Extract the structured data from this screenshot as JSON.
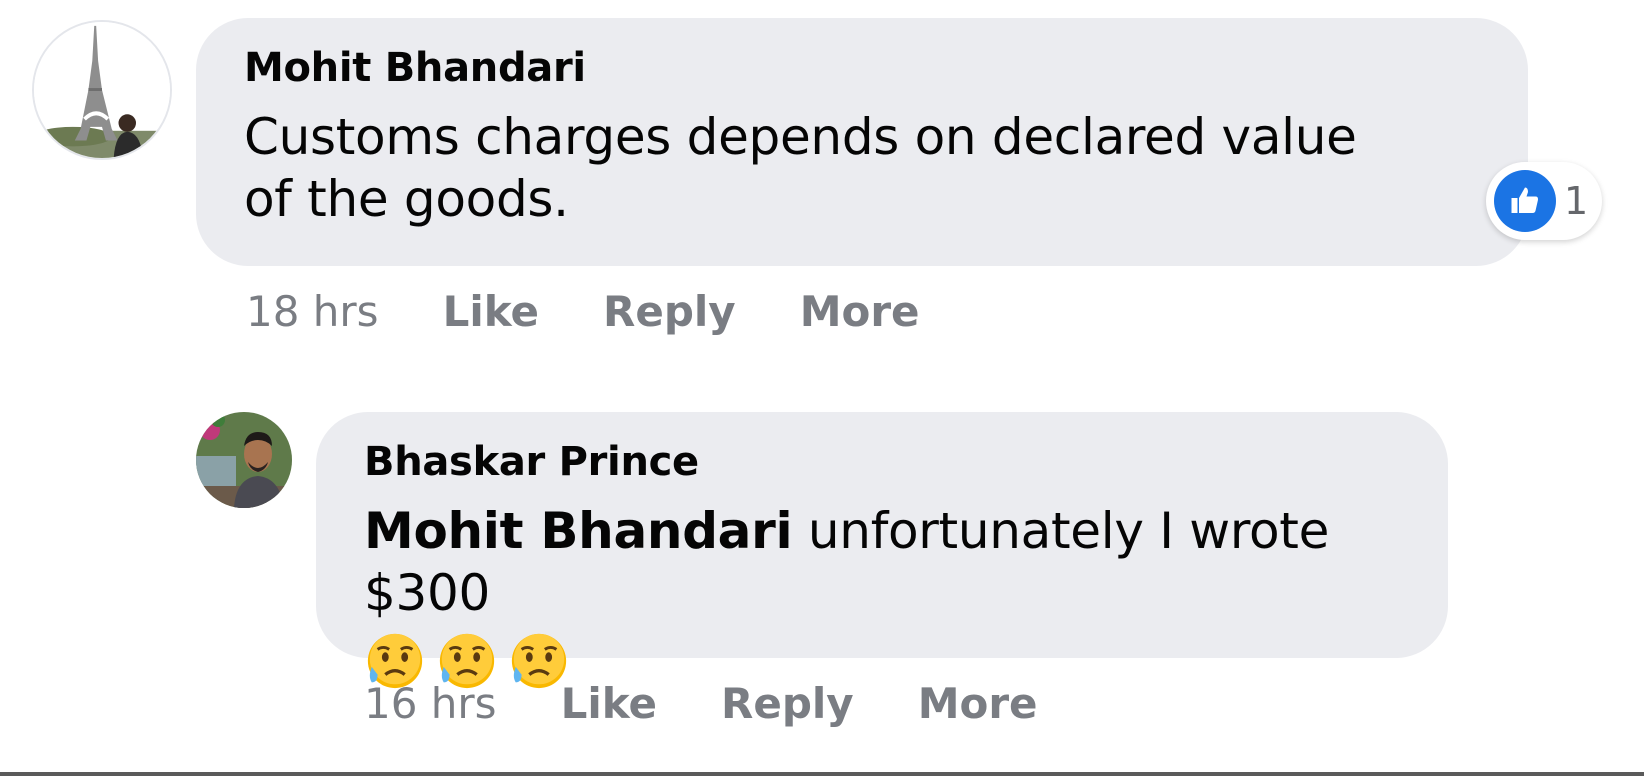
{
  "comments": [
    {
      "author": "Mohit Bhandari",
      "text": "Customs charges depends on declared value of the goods.",
      "time": "18 hrs",
      "actions": {
        "like": "Like",
        "reply": "Reply",
        "more": "More"
      },
      "reaction": {
        "icon": "thumbs-up-icon",
        "count": "1",
        "color": "#1b74e4"
      }
    },
    {
      "author": "Bhaskar Prince",
      "mention": "Mohit Bhandari",
      "text": "unfortunately I wrote $300",
      "emojis": [
        "😥",
        "😥",
        "😥"
      ],
      "time": "16 hrs",
      "actions": {
        "like": "Like",
        "reply": "Reply",
        "more": "More"
      }
    }
  ]
}
